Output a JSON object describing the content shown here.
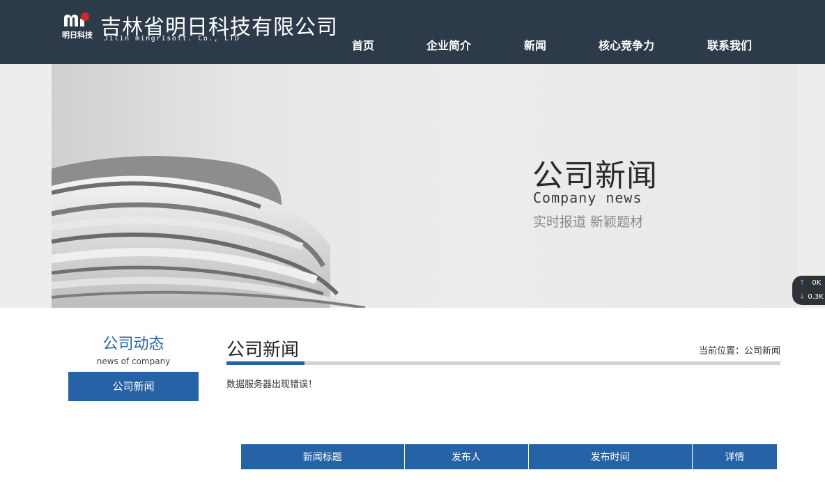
{
  "header": {
    "logo_text": "明日科技",
    "company_name": "吉林省明日科技有限公司",
    "company_en": "Jilin mingrisoft. Co., LTD",
    "nav": [
      {
        "label": "首页"
      },
      {
        "label": "企业简介"
      },
      {
        "label": "新闻"
      },
      {
        "label": "核心竞争力"
      },
      {
        "label": "联系我们"
      }
    ]
  },
  "banner": {
    "title": "公司新闻",
    "subtitle_en": "Company news",
    "subtitle_cn": "实时报道 新颖题材"
  },
  "speed_widget": {
    "up": "0K",
    "down": "0.3K"
  },
  "sidebar": {
    "title": "公司动态",
    "subtitle": "news of company",
    "items": [
      {
        "label": "公司新闻"
      }
    ]
  },
  "main": {
    "title": "公司新闻",
    "breadcrumb": "当前位置：公司新闻",
    "error_message": "数据服务器出现错误！",
    "table_headers": [
      "新闻标题",
      "发布人",
      "发布时间",
      "详情"
    ]
  },
  "colors": {
    "header_bg": "#2c3a4a",
    "accent": "#2563a6"
  }
}
